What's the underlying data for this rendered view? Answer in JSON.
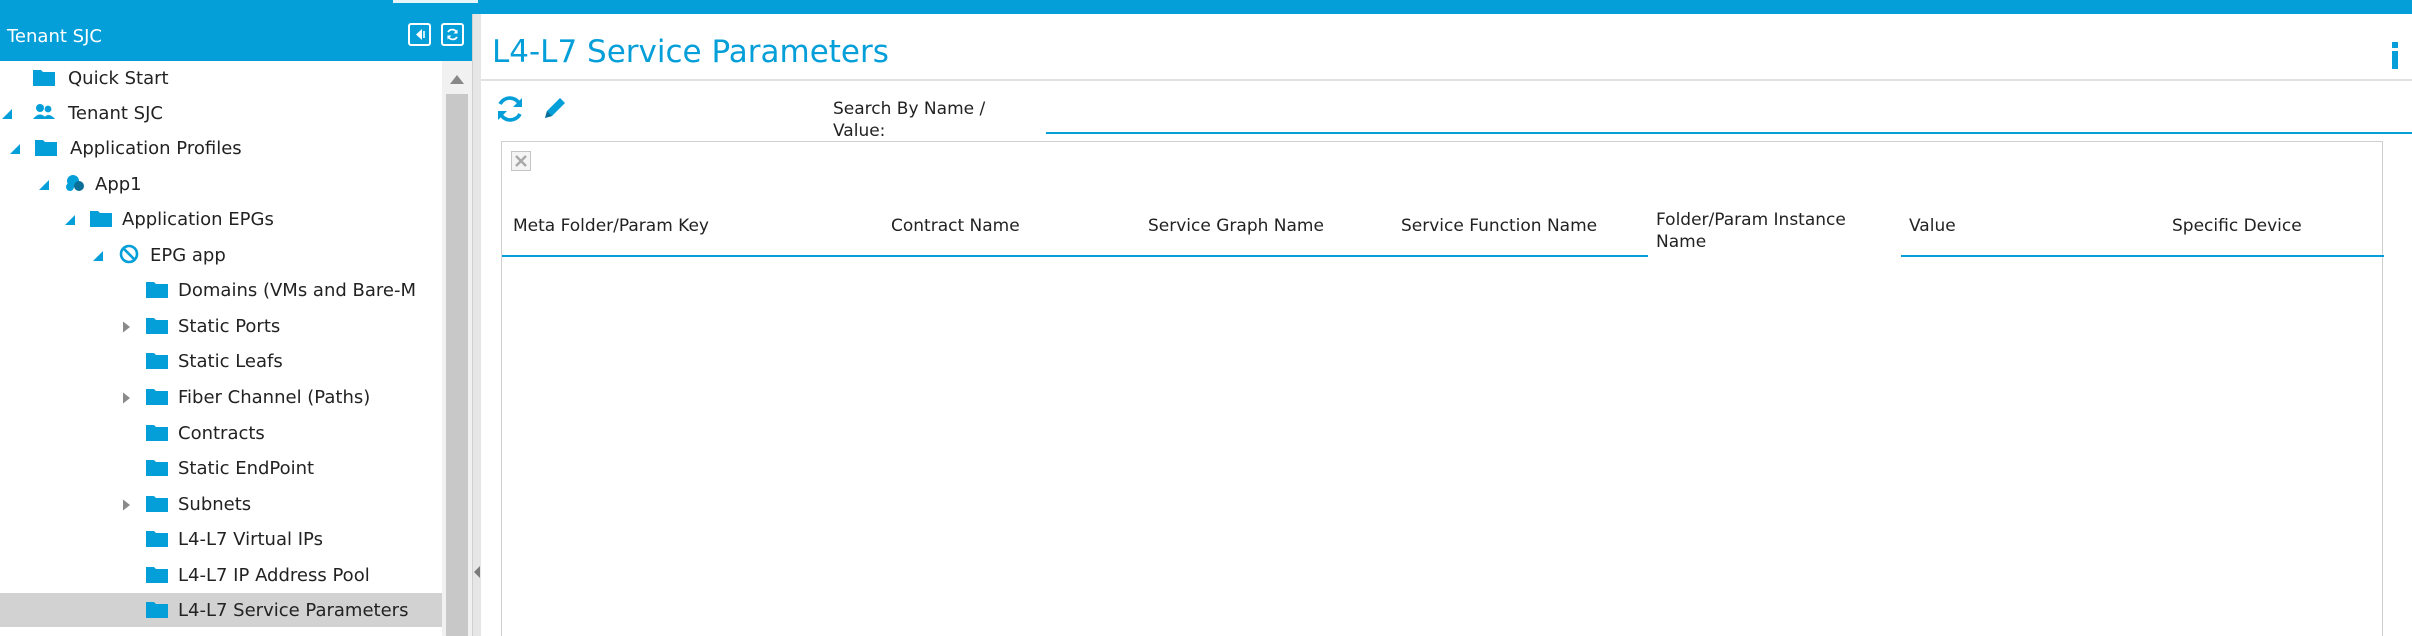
{
  "left_panel": {
    "title": "Tenant SJC",
    "tree": [
      {
        "label": "Quick Start",
        "level": 0,
        "arrow": "none",
        "icon": "folder-icon"
      },
      {
        "label": "Tenant SJC",
        "level": 0,
        "arrow": "expanded",
        "icon": "tenant-icon"
      },
      {
        "label": "Application Profiles",
        "level": 1,
        "arrow": "expanded",
        "icon": "folder-icon"
      },
      {
        "label": "App1",
        "level": 2,
        "arrow": "expanded",
        "icon": "app-profile-icon"
      },
      {
        "label": "Application EPGs",
        "level": 3,
        "arrow": "expanded",
        "icon": "folder-icon"
      },
      {
        "label": "EPG app",
        "level": 4,
        "arrow": "expanded",
        "icon": "epg-icon"
      },
      {
        "label": "Domains (VMs and Bare-M",
        "level": 5,
        "arrow": "none",
        "icon": "folder-icon"
      },
      {
        "label": "Static Ports",
        "level": 5,
        "arrow": "collapsed",
        "icon": "folder-icon"
      },
      {
        "label": "Static Leafs",
        "level": 5,
        "arrow": "none",
        "icon": "folder-icon"
      },
      {
        "label": "Fiber Channel (Paths)",
        "level": 5,
        "arrow": "collapsed",
        "icon": "folder-icon"
      },
      {
        "label": "Contracts",
        "level": 5,
        "arrow": "none",
        "icon": "folder-icon"
      },
      {
        "label": "Static EndPoint",
        "level": 5,
        "arrow": "none",
        "icon": "folder-icon"
      },
      {
        "label": "Subnets",
        "level": 5,
        "arrow": "collapsed",
        "icon": "folder-icon"
      },
      {
        "label": "L4-L7 Virtual IPs",
        "level": 5,
        "arrow": "none",
        "icon": "folder-icon"
      },
      {
        "label": "L4-L7 IP Address Pool",
        "level": 5,
        "arrow": "none",
        "icon": "folder-icon"
      },
      {
        "label": "L4-L7 Service Parameters",
        "level": 5,
        "arrow": "none",
        "icon": "folder-icon",
        "selected": true
      }
    ]
  },
  "main": {
    "title": "L4-L7 Service Parameters",
    "search": {
      "label_line1": "Search By Name /",
      "label_line2": "Value:",
      "value": "",
      "placeholder": ""
    },
    "table": {
      "columns": [
        {
          "line1": "Meta Folder/Param Key",
          "line2": ""
        },
        {
          "line1": "Contract Name",
          "line2": ""
        },
        {
          "line1": "Service Graph Name",
          "line2": ""
        },
        {
          "line1": "Service Function Name",
          "line2": ""
        },
        {
          "line1": "Folder/Param Instance",
          "line2": "Name"
        },
        {
          "line1": "Value",
          "line2": ""
        },
        {
          "line1": "Specific Device",
          "line2": ""
        }
      ],
      "rows": []
    }
  },
  "colors": {
    "accent": "#049fd9",
    "selected_row": "#d2d2d2"
  }
}
